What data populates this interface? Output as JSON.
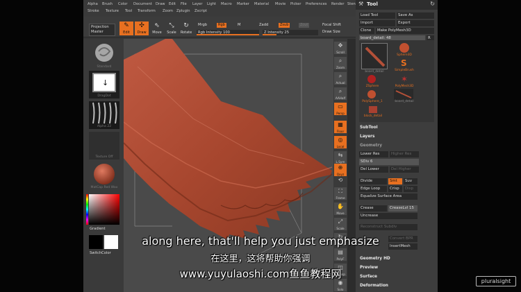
{
  "menu": [
    "Alpha",
    "Brush",
    "Color",
    "Document",
    "Draw",
    "Edit",
    "File",
    "Layer",
    "Light",
    "Macro",
    "Marker",
    "Material",
    "Movie",
    "Picker",
    "Preferences",
    "Render",
    "Stencil",
    "Stroke",
    "Texture",
    "Tool",
    "Transform",
    "Zoom",
    "Zplugin",
    "Zscript"
  ],
  "toolbar": {
    "projection_master": "Projection Master",
    "edit": "Edit",
    "draw": "Draw",
    "move": "Move",
    "scale": "Scale",
    "rotate": "Rotate",
    "mrgb": "Mrgb",
    "rgb": "Rgb",
    "m": "M",
    "rgb_intensity": "Rgb Intensity 100",
    "zadd": "Zadd",
    "zsub": "Zsub",
    "zcut": "Zcut",
    "z_intensity": "Z Intensity 25",
    "focal_shift": "Focal Shift",
    "draw_size": "Draw Size"
  },
  "shelf": {
    "thumb_labels": [
      "Standard",
      "DragDot",
      "Alpha 22",
      "Texture Off",
      "MatCap Red Wax"
    ],
    "gradient": "Gradient",
    "switch_color": "SwitchColor"
  },
  "iconcol": [
    "Scroll",
    "Zoom",
    "Actual",
    "AAHalf",
    "Persp",
    "Floor",
    "Local",
    "L.Sym",
    "Qxyz",
    "",
    "Frame",
    "Move",
    "Scale",
    "Rotate",
    "PolyF",
    "Transp",
    "Solo"
  ],
  "palette": {
    "title": "Tool",
    "buttons": [
      "Load Tool",
      "Save As",
      "Import",
      "Export",
      "Clone",
      "Make PolyMesh3D"
    ],
    "current_tool": "board_detail: 48",
    "current_tool_field": "R",
    "tools": [
      "board_detail",
      "Sphere3D",
      "SimpleBrush",
      "ZSphere",
      "PolyMesh3D",
      "PolySphere_1",
      "board_detail",
      "block_detail"
    ],
    "sections": [
      "SubTool",
      "Layers",
      "Geometry",
      "Geometry HD",
      "Preview",
      "Surface",
      "Deformation"
    ],
    "geometry": {
      "lower_res": "Lower Res",
      "higher_res": "Higher Res",
      "sdiv": "SDiv 6",
      "del_lower": "Del Lower",
      "del_higher": "Del Higher",
      "divide": "Divide",
      "smt": "Smt",
      "suv": "Suv",
      "edge_loop": "Edge Loop",
      "crisp": "Crisp",
      "disp": "Disp",
      "equalize": "Equalize Surface Area",
      "crease": "Crease",
      "crease_lvl": "CreaseLvl 15",
      "uncrease": "Uncrease",
      "reconstruct": "Reconstruct Subdiv",
      "convert_bpr": "Convert BPR",
      "insert_mesh": "InsertMesh"
    }
  },
  "subtitles": {
    "en": "along here, that'll help you just emphasize",
    "zh": "在这里，这将帮助你强调",
    "watermark": "www.yuyulaoshi.com鱼鱼教程网"
  },
  "logo": "pluralsight",
  "colors": {
    "accent": "#e87020",
    "model": "#b45038",
    "canvas": "#4a4a4a"
  }
}
